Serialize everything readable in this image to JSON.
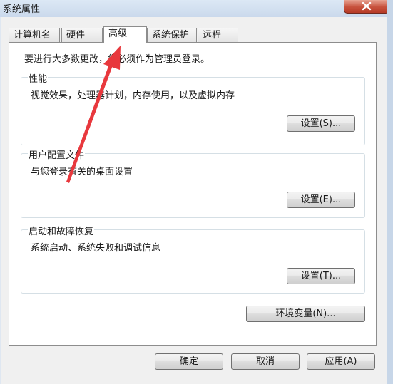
{
  "window": {
    "title": "系统属性"
  },
  "tabs": [
    {
      "label": "计算机名"
    },
    {
      "label": "硬件"
    },
    {
      "label": "高级"
    },
    {
      "label": "系统保护"
    },
    {
      "label": "远程"
    }
  ],
  "advanced": {
    "intro": "要进行大多数更改，您必须作为管理员登录。",
    "performance": {
      "title": "性能",
      "desc": "视觉效果，处理器计划，内存使用，以及虚拟内存",
      "button": "设置(S)..."
    },
    "user_profiles": {
      "title": "用户配置文件",
      "desc": "与您登录有关的桌面设置",
      "button": "设置(E)..."
    },
    "startup_recovery": {
      "title": "启动和故障恢复",
      "desc": "系统启动、系统失败和调试信息",
      "button": "设置(T)..."
    },
    "env_button": "环境变量(N)..."
  },
  "footer": {
    "ok": "确定",
    "cancel": "取消",
    "apply": "应用(A)"
  },
  "colors": {
    "annotation_arrow": "#e8383d",
    "close_button": "#c7513c"
  }
}
